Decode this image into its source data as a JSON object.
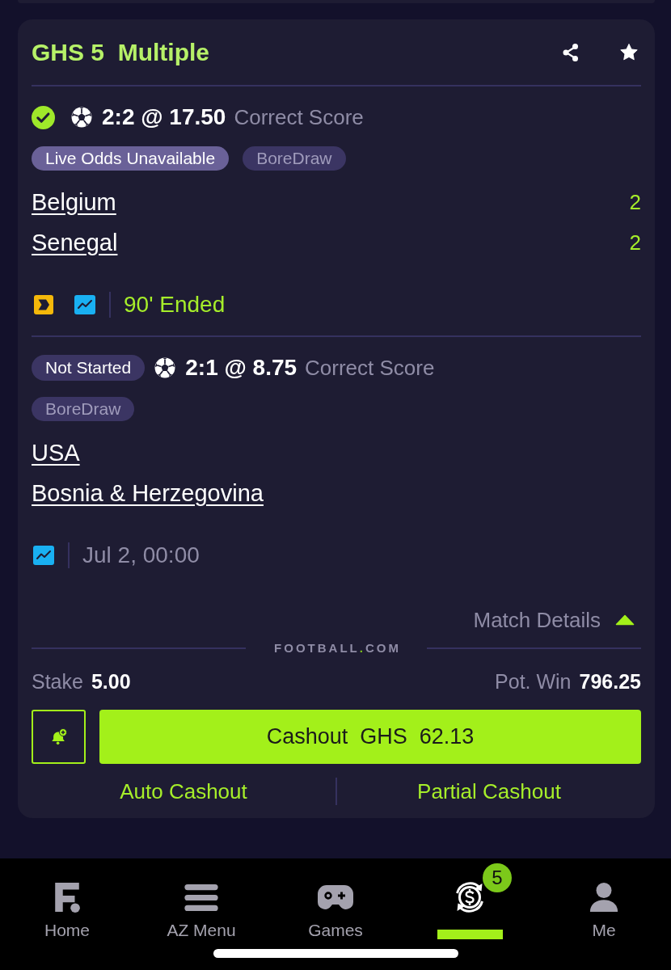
{
  "bet": {
    "title": "GHS 5  Multiple",
    "selections": [
      {
        "status": {
          "kind": "won"
        },
        "pick": "2:2 @ 17.50",
        "market": "Correct Score",
        "tags": [
          {
            "label": "Live Odds Unavailable",
            "kind": "notice"
          },
          {
            "label": "BoreDraw",
            "kind": "plain"
          }
        ],
        "teams": [
          {
            "name": "Belgium",
            "score": "2"
          },
          {
            "name": "Senegal",
            "score": "2"
          }
        ],
        "live_tracker": true,
        "time": {
          "text": "90' Ended",
          "kind": "live"
        }
      },
      {
        "status": {
          "kind": "pending",
          "label": "Not Started"
        },
        "pick": "2:1 @ 8.75",
        "market": "Correct Score",
        "tags": [
          {
            "label": "BoreDraw",
            "kind": "plain"
          }
        ],
        "teams": [
          {
            "name": "USA"
          },
          {
            "name": "Bosnia & Herzegovina"
          }
        ],
        "live_tracker": false,
        "time": {
          "text": "Jul 2, 00:00",
          "kind": "scheduled"
        }
      }
    ],
    "match_details": {
      "label": "Match Details",
      "expanded": true
    },
    "brand": {
      "parts": [
        "FOOTBALL",
        ".",
        "COM"
      ]
    },
    "stake": {
      "label": "Stake",
      "value": "5.00"
    },
    "potential_win": {
      "label": "Pot. Win",
      "value": "796.25"
    },
    "cashout_button": "Cashout  GHS  62.13",
    "links": [
      "Auto Cashout",
      "Partial Cashout"
    ]
  },
  "nav": {
    "items": [
      {
        "kind": "home",
        "label": "Home",
        "selected": false
      },
      {
        "kind": "menu",
        "label": "AZ Menu",
        "selected": false
      },
      {
        "kind": "games",
        "label": "Games",
        "selected": false
      },
      {
        "kind": "cashout",
        "badge": "5",
        "selected": true
      },
      {
        "kind": "me",
        "label": "Me",
        "selected": false
      }
    ]
  }
}
